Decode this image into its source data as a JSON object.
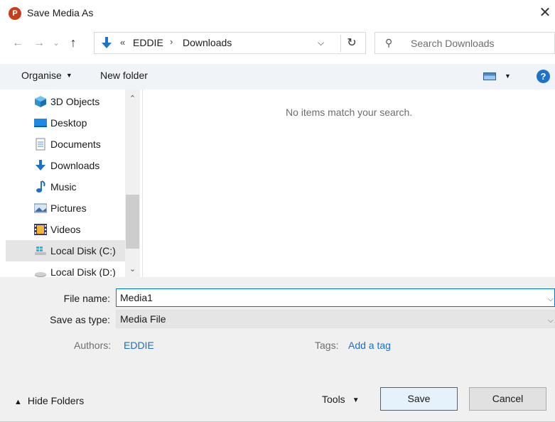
{
  "window": {
    "title": "Save Media As",
    "app_icon_letter": "P"
  },
  "address": {
    "overflow": "«",
    "segments": [
      "EDDIE",
      "Downloads"
    ]
  },
  "search": {
    "placeholder": "Search Downloads"
  },
  "toolbar": {
    "organise_label": "Organise",
    "new_folder_label": "New folder",
    "help_label": "?"
  },
  "nav": {
    "items": [
      {
        "label": "3D Objects",
        "icon": "cube-icon"
      },
      {
        "label": "Desktop",
        "icon": "desktop-icon"
      },
      {
        "label": "Documents",
        "icon": "document-icon"
      },
      {
        "label": "Downloads",
        "icon": "download-arrow-icon"
      },
      {
        "label": "Music",
        "icon": "music-note-icon"
      },
      {
        "label": "Pictures",
        "icon": "pictures-icon"
      },
      {
        "label": "Videos",
        "icon": "videos-icon"
      },
      {
        "label": "Local Disk (C:)",
        "icon": "windows-drive-icon"
      },
      {
        "label": "Local Disk (D:)",
        "icon": "drive-icon"
      }
    ]
  },
  "filelist": {
    "empty_message": "No items match your search."
  },
  "form": {
    "file_name_label": "File name:",
    "file_name_value": "Media1",
    "save_type_label": "Save as type:",
    "save_type_value": "Media File",
    "authors_label": "Authors:",
    "authors_value": "EDDIE",
    "tags_label": "Tags:",
    "tags_value": "Add a tag"
  },
  "footer": {
    "hide_folders_label": "Hide Folders",
    "tools_label": "Tools",
    "save_label": "Save",
    "cancel_label": "Cancel"
  },
  "colors": {
    "accent": "#0078d7",
    "link": "#1b6fc7",
    "toolbar_bg": "#f0f4f9",
    "bottom_bg": "#f0f0f0",
    "selected_bg": "#cce8ff"
  }
}
